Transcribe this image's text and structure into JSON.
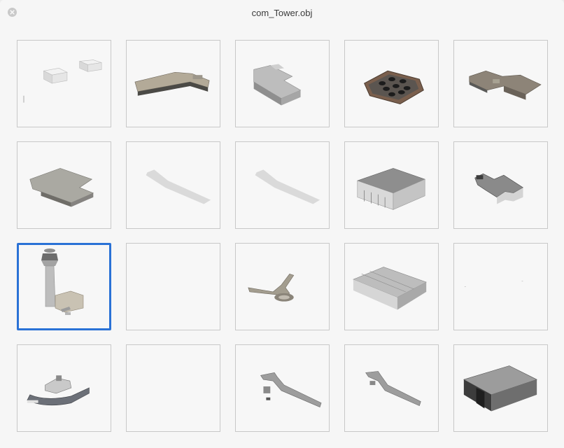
{
  "window": {
    "title": "com_Tower.obj",
    "close_icon": "close-icon"
  },
  "accent_color": "#2a72d6",
  "thumbnails": [
    {
      "name": "small-buildings-model",
      "selected": false
    },
    {
      "name": "l-shaped-terminal-model",
      "selected": false
    },
    {
      "name": "l-shaped-building-model",
      "selected": false
    },
    {
      "name": "round-pad-model",
      "selected": false
    },
    {
      "name": "terminal-complex-model",
      "selected": false
    },
    {
      "name": "flat-roof-building-model",
      "selected": false
    },
    {
      "name": "ground-shadow-model",
      "selected": false
    },
    {
      "name": "ground-shadow-model-2",
      "selected": false
    },
    {
      "name": "hangar-building-model",
      "selected": false
    },
    {
      "name": "stepped-building-model",
      "selected": false
    },
    {
      "name": "control-tower-model",
      "selected": true
    },
    {
      "name": "empty-model",
      "selected": false
    },
    {
      "name": "y-shaped-walkway-model",
      "selected": false
    },
    {
      "name": "large-hangar-model",
      "selected": false
    },
    {
      "name": "empty-model-2",
      "selected": false
    },
    {
      "name": "curved-terminal-model",
      "selected": false
    },
    {
      "name": "empty-model-3",
      "selected": false
    },
    {
      "name": "long-walkway-model",
      "selected": false
    },
    {
      "name": "long-walkway-model-2",
      "selected": false
    },
    {
      "name": "dark-hangar-model",
      "selected": false
    }
  ]
}
